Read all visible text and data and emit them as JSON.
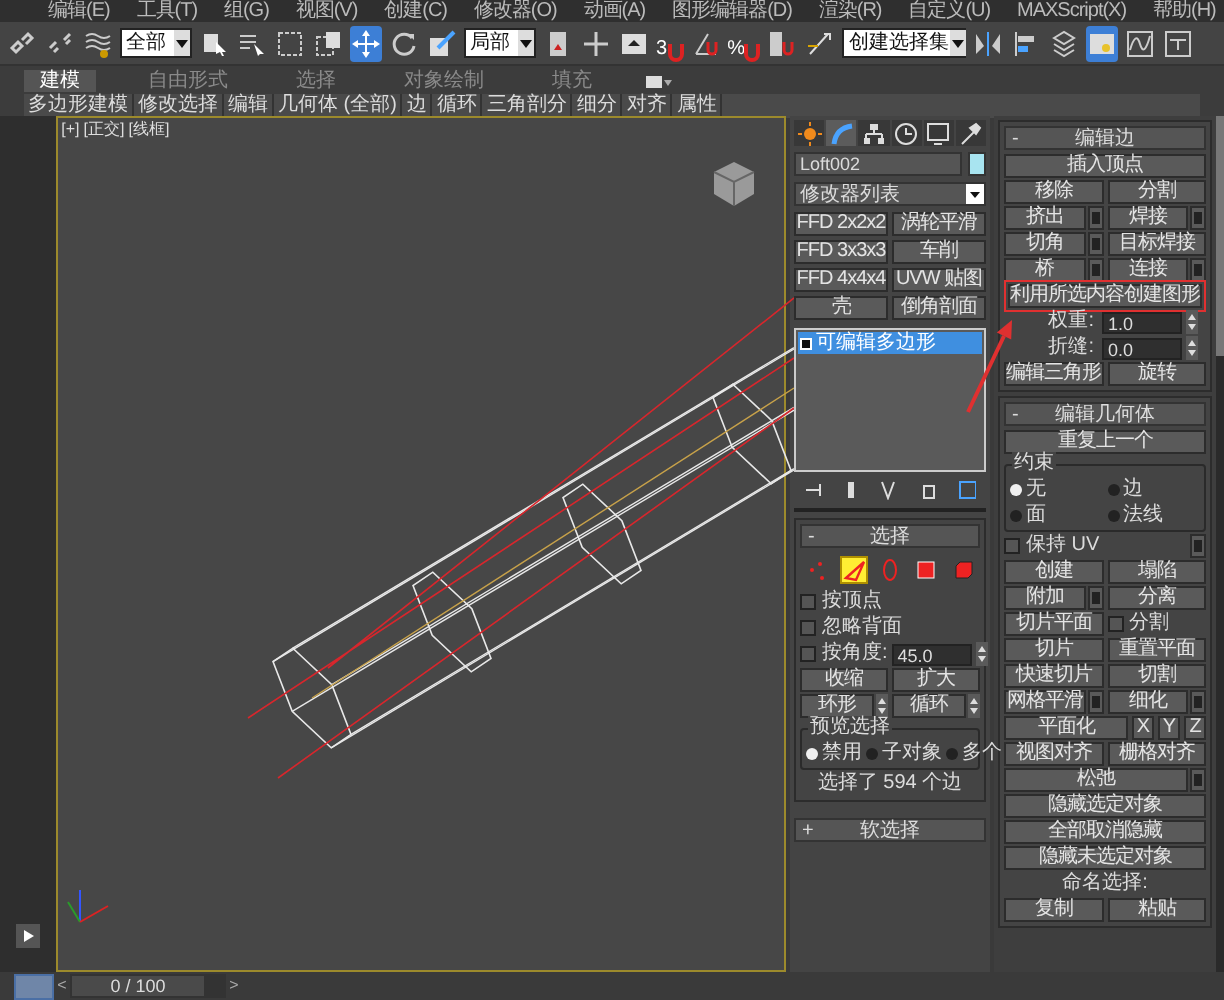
{
  "menu_bar": [
    "编辑(E)",
    "工具(T)",
    "组(G)",
    "视图(V)",
    "创建(C)",
    "修改器(O)",
    "动画(A)",
    "图形编辑器(D)",
    "渲染(R)",
    "自定义(U)",
    "MAXScript(X)",
    "帮助(H)"
  ],
  "toolbar": {
    "selection_filter": "全部",
    "reference_coordinate": "局部",
    "snap_label": "3",
    "percent_snap_label": "%",
    "named_selection_set": "创建选择集",
    "move_tool": {
      "selected": true
    },
    "scene_explorer": {
      "selected": true
    }
  },
  "ribbon": {
    "tabs": [
      {
        "label": "建模",
        "selected": true
      },
      {
        "label": "自由形式",
        "selected": false
      },
      {
        "label": "选择",
        "selected": false
      },
      {
        "label": "对象绘制",
        "selected": false
      },
      {
        "label": "填充",
        "selected": false
      }
    ],
    "panels": [
      "多边形建模",
      "修改选择",
      "编辑",
      "几何体 (全部)",
      "边",
      "循环",
      "三角剖分",
      "细分",
      "对齐",
      "属性"
    ]
  },
  "viewport": {
    "labels": [
      "[+]",
      "[正交]",
      "[线框]"
    ]
  },
  "command_panel": {
    "tabs": [
      {
        "kind": "create",
        "selected": false
      },
      {
        "kind": "modify",
        "selected": true
      },
      {
        "kind": "hierarchy",
        "selected": false
      },
      {
        "kind": "motion",
        "selected": false
      },
      {
        "kind": "display",
        "selected": false
      },
      {
        "kind": "utilities",
        "selected": false
      }
    ],
    "object_name": "Loft002",
    "modifier_list": "修改器列表",
    "modifier_buttons": [
      "FFD 2x2x2",
      "涡轮平滑",
      "FFD 3x3x3",
      "车削",
      "FFD 4x4x4",
      "UVW 贴图",
      "壳",
      "倒角剖面"
    ],
    "stack": [
      {
        "label": "可编辑多边形",
        "selected": true
      }
    ],
    "selection": {
      "sign": "-",
      "title": "选择",
      "subobject_levels": [
        {
          "kind": "vertex",
          "selected": false
        },
        {
          "kind": "edge",
          "selected": true
        },
        {
          "kind": "border",
          "selected": false
        },
        {
          "kind": "polygon",
          "selected": false
        },
        {
          "kind": "element",
          "selected": false
        }
      ],
      "rows": [
        {
          "controls": [
            {
              "kind": "checkbox",
              "label": "按顶点",
              "checked": false
            }
          ]
        },
        {
          "controls": [
            {
              "kind": "checkbox",
              "label": "忽略背面",
              "checked": false
            }
          ]
        },
        {
          "controls": [
            {
              "kind": "checkbox",
              "label": "按角度:",
              "checked": false
            },
            {
              "kind": "spinner",
              "value": "45.0"
            }
          ]
        },
        {
          "controls": [
            {
              "kind": "button",
              "label": "收缩"
            },
            {
              "kind": "button",
              "label": "扩大"
            }
          ]
        },
        {
          "controls": [
            {
              "kind": "button",
              "label": "环形",
              "spinner_arrows": true
            },
            {
              "kind": "button",
              "label": "循环",
              "spinner_arrows": true
            }
          ]
        },
        {
          "group": "预览选择",
          "rows": [
            {
              "controls": [
                {
                  "kind": "radio",
                  "label": "禁用",
                  "selected": true
                },
                {
                  "kind": "radio",
                  "label": "子对象",
                  "selected": false
                },
                {
                  "kind": "radio",
                  "label": "多个",
                  "selected": false
                }
              ]
            }
          ]
        },
        {
          "controls": [
            {
              "kind": "text",
              "label": "选择了 594 个边"
            }
          ]
        }
      ]
    },
    "soft_selection": {
      "sign": "+",
      "title": "软选择"
    }
  },
  "edit_edges": {
    "sign": "-",
    "title": "编辑边",
    "rows": [
      {
        "controls": [
          {
            "kind": "button",
            "label": "插入顶点"
          }
        ]
      },
      {
        "controls": [
          {
            "kind": "button",
            "label": "移除"
          },
          {
            "kind": "button",
            "label": "分割"
          }
        ]
      },
      {
        "controls": [
          {
            "kind": "button",
            "label": "挤出",
            "settings": true
          },
          {
            "kind": "button",
            "label": "焊接",
            "settings": true
          }
        ]
      },
      {
        "controls": [
          {
            "kind": "button",
            "label": "切角",
            "settings": true
          },
          {
            "kind": "button",
            "label": "目标焊接"
          }
        ]
      },
      {
        "controls": [
          {
            "kind": "button",
            "label": "桥",
            "settings": true
          },
          {
            "kind": "button",
            "label": "连接",
            "settings": true
          }
        ]
      },
      {
        "controls": [
          {
            "kind": "button",
            "label": "利用所选内容创建图形",
            "annotated": true
          }
        ]
      },
      {
        "controls": [
          {
            "kind": "spinner",
            "label": "权重:",
            "value": "1.0"
          }
        ]
      },
      {
        "controls": [
          {
            "kind": "spinner",
            "label": "折缝:",
            "value": "0.0"
          }
        ]
      },
      {
        "controls": [
          {
            "kind": "button",
            "label": "编辑三角形"
          },
          {
            "kind": "button",
            "label": "旋转"
          }
        ]
      }
    ]
  },
  "edit_geometry": {
    "sign": "-",
    "title": "编辑几何体",
    "rows": [
      {
        "controls": [
          {
            "kind": "button",
            "label": "重复上一个"
          }
        ]
      },
      {
        "group": "约束",
        "rows": [
          {
            "controls": [
              {
                "kind": "radio",
                "label": "无",
                "selected": true
              },
              {
                "kind": "radio",
                "label": "边",
                "selected": false
              }
            ]
          },
          {
            "controls": [
              {
                "kind": "radio",
                "label": "面",
                "selected": false
              },
              {
                "kind": "radio",
                "label": "法线",
                "selected": false
              }
            ]
          }
        ]
      },
      {
        "controls": [
          {
            "kind": "checkbox",
            "label": "保持 UV",
            "checked": false
          },
          {
            "kind": "settings"
          }
        ]
      },
      {
        "controls": [
          {
            "kind": "button",
            "label": "创建"
          },
          {
            "kind": "button",
            "label": "塌陷"
          }
        ]
      },
      {
        "controls": [
          {
            "kind": "button",
            "label": "附加",
            "settings": true
          },
          {
            "kind": "button",
            "label": "分离"
          }
        ]
      },
      {
        "controls": [
          {
            "kind": "button",
            "label": "切片平面"
          },
          {
            "kind": "checkbox",
            "label": "分割",
            "checked": false
          }
        ]
      },
      {
        "controls": [
          {
            "kind": "button",
            "label": "切片"
          },
          {
            "kind": "button",
            "label": "重置平面"
          }
        ]
      },
      {
        "controls": [
          {
            "kind": "button",
            "label": "快速切片"
          },
          {
            "kind": "button",
            "label": "切割"
          }
        ]
      },
      {
        "controls": [
          {
            "kind": "button",
            "label": "网格平滑",
            "settings": true
          },
          {
            "kind": "button",
            "label": "细化",
            "settings": true
          }
        ]
      },
      {
        "controls": [
          {
            "kind": "button",
            "label": "平面化"
          },
          {
            "kind": "small_button",
            "label": "X"
          },
          {
            "kind": "small_button",
            "label": "Y"
          },
          {
            "kind": "small_button",
            "label": "Z"
          }
        ]
      },
      {
        "controls": [
          {
            "kind": "button",
            "label": "视图对齐"
          },
          {
            "kind": "button",
            "label": "栅格对齐"
          }
        ]
      },
      {
        "controls": [
          {
            "kind": "button",
            "label": "松弛",
            "settings": true
          }
        ]
      },
      {
        "controls": [
          {
            "kind": "button",
            "label": "隐藏选定对象"
          }
        ]
      },
      {
        "controls": [
          {
            "kind": "button",
            "label": "全部取消隐藏"
          }
        ]
      },
      {
        "controls": [
          {
            "kind": "button",
            "label": "隐藏未选定对象"
          }
        ]
      },
      {
        "controls": [
          {
            "kind": "text",
            "label": "命名选择:"
          }
        ]
      },
      {
        "controls": [
          {
            "kind": "button",
            "label": "复制"
          },
          {
            "kind": "button",
            "label": "粘贴"
          }
        ]
      }
    ]
  },
  "timeline": {
    "previous": "<",
    "frame": "0 / 100",
    "next": ">",
    "level": 0
  }
}
